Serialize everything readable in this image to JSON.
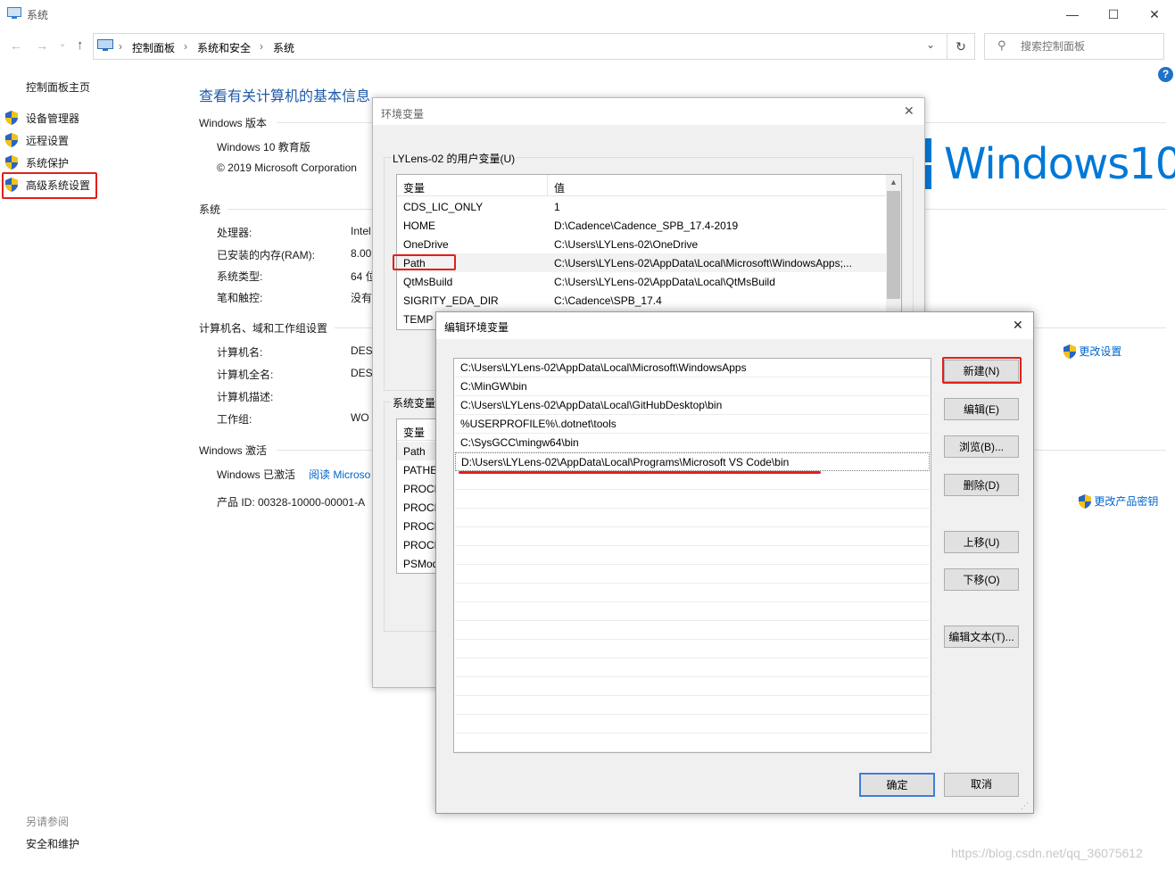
{
  "window": {
    "title": "系统",
    "minimize": "—",
    "maximize": "☐",
    "close": "✕"
  },
  "breadcrumb": [
    "控制面板",
    "系统和安全",
    "系统"
  ],
  "search": {
    "placeholder": "搜索控制面板"
  },
  "sidebar": {
    "home": "控制面板主页",
    "items": [
      "设备管理器",
      "远程设置",
      "系统保护",
      "高级系统设置"
    ],
    "see_also_title": "另请参阅",
    "see_also_items": [
      "安全和维护"
    ]
  },
  "main": {
    "title": "查看有关计算机的基本信息",
    "windows_edition": {
      "heading": "Windows 版本",
      "edition": "Windows 10 教育版",
      "copyright": "© 2019 Microsoft Corporation"
    },
    "system": {
      "heading": "系统",
      "rows": [
        {
          "label": "处理器:",
          "value": "Intel"
        },
        {
          "label": "已安装的内存(RAM):",
          "value": "8.00"
        },
        {
          "label": "系统类型:",
          "value": "64 位"
        },
        {
          "label": "笔和触控:",
          "value": "没有"
        }
      ]
    },
    "computer": {
      "heading": "计算机名、域和工作组设置",
      "rows": [
        {
          "label": "计算机名:",
          "value": "DES"
        },
        {
          "label": "计算机全名:",
          "value": "DES"
        },
        {
          "label": "计算机描述:",
          "value": ""
        },
        {
          "label": "工作组:",
          "value": "WO"
        }
      ],
      "change_link": "更改设置"
    },
    "activation": {
      "heading": "Windows 激活",
      "status": "Windows 已激活",
      "read_link": "阅读 Microso",
      "product_id": "产品 ID: 00328-10000-00001-A",
      "change_key_link": "更改产品密钥"
    },
    "logo_text": "Windows",
    "logo_num": "10"
  },
  "env_dialog": {
    "title": "环境变量",
    "user_group_label": "LYLens-02 的用户变量(U)",
    "headers": [
      "变量",
      "值"
    ],
    "user_vars": [
      {
        "name": "CDS_LIC_ONLY",
        "value": "1"
      },
      {
        "name": "HOME",
        "value": "D:\\Cadence\\Cadence_SPB_17.4-2019"
      },
      {
        "name": "OneDrive",
        "value": "C:\\Users\\LYLens-02\\OneDrive"
      },
      {
        "name": "Path",
        "value": "C:\\Users\\LYLens-02\\AppData\\Local\\Microsoft\\WindowsApps;..."
      },
      {
        "name": "QtMsBuild",
        "value": "C:\\Users\\LYLens-02\\AppData\\Local\\QtMsBuild"
      },
      {
        "name": "SIGRITY_EDA_DIR",
        "value": "C:\\Cadence\\SPB_17.4"
      },
      {
        "name": "TEMP",
        "value": ""
      }
    ],
    "system_group_label": "系统变量",
    "system_header": "变量",
    "system_vars": [
      "Path",
      "PATHE",
      "PROCE",
      "PROCE",
      "PROCE",
      "PROCE",
      "PSMod"
    ]
  },
  "edit_dialog": {
    "title": "编辑环境变量",
    "entries": [
      "C:\\Users\\LYLens-02\\AppData\\Local\\Microsoft\\WindowsApps",
      "C:\\MinGW\\bin",
      "C:\\Users\\LYLens-02\\AppData\\Local\\GitHubDesktop\\bin",
      "%USERPROFILE%\\.dotnet\\tools",
      "C:\\SysGCC\\mingw64\\bin",
      "D:\\Users\\LYLens-02\\AppData\\Local\\Programs\\Microsoft VS Code\\bin"
    ],
    "buttons": {
      "new": "新建(N)",
      "edit": "编辑(E)",
      "browse": "浏览(B)...",
      "delete": "删除(D)",
      "up": "上移(U)",
      "down": "下移(O)",
      "edit_text": "编辑文本(T)...",
      "ok": "确定",
      "cancel": "取消"
    }
  },
  "watermark": "https://blog.csdn.net/qq_36075612",
  "colors": {
    "accent": "#1e5aa8",
    "link": "#0066cc",
    "highlight_red": "#e0201b",
    "logo_blue": "#0078d7"
  }
}
